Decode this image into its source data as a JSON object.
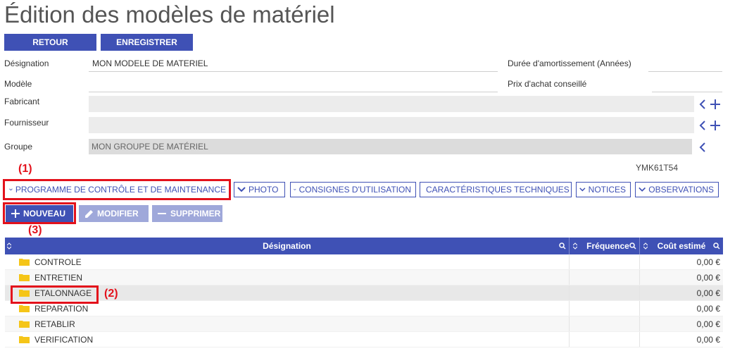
{
  "page": {
    "title": "Édition des modèles de matériel"
  },
  "toolbar": {
    "back_label": "RETOUR",
    "save_label": "ENREGISTRER"
  },
  "form": {
    "designation_label": "Désignation",
    "designation_value": "MON MODELE DE MATERIEL",
    "modele_label": "Modèle",
    "modele_value": "",
    "fabricant_label": "Fabricant",
    "fournisseur_label": "Fournisseur",
    "groupe_label": "Groupe",
    "groupe_value": "MON GROUPE DE MATÉRIEL",
    "duree_label": "Durée d'amortissement (Années)",
    "duree_value": "",
    "prix_label": "Prix d'achat conseillé",
    "prix_value": "",
    "code": "YMK61T54"
  },
  "tabs": [
    {
      "label": "PROGRAMME DE CONTRÔLE ET DE MAINTENANCE"
    },
    {
      "label": "PHOTO"
    },
    {
      "label": "CONSIGNES D'UTILISATION"
    },
    {
      "label": "CARACTÉRISTIQUES TECHNIQUES"
    },
    {
      "label": "NOTICES"
    },
    {
      "label": "OBSERVATIONS"
    }
  ],
  "actions": {
    "new_label": "NOUVEAU",
    "edit_label": "MODIFIER",
    "delete_label": "SUPPRIMER"
  },
  "annotations": {
    "a1": "(1)",
    "a2": "(2)",
    "a3": "(3)"
  },
  "table": {
    "columns": [
      "Désignation",
      "Fréquence",
      "Coût estimé"
    ],
    "rows": [
      {
        "designation": "CONTROLE",
        "frequence": "",
        "cout": "0,00 €"
      },
      {
        "designation": "ENTRETIEN",
        "frequence": "",
        "cout": "0,00 €"
      },
      {
        "designation": "ETALONNAGE",
        "frequence": "",
        "cout": "0,00 €"
      },
      {
        "designation": "REPARATION",
        "frequence": "",
        "cout": "0,00 €"
      },
      {
        "designation": "RETABLIR",
        "frequence": "",
        "cout": "0,00 €"
      },
      {
        "designation": "VERIFICATION",
        "frequence": "",
        "cout": "0,00 €"
      }
    ]
  },
  "colors": {
    "primary": "#3f51b5",
    "primary_disabled": "#9fa8da",
    "highlight": "#e3111b",
    "folder": "#f5c518"
  },
  "icons": [
    "chevron-left-icon",
    "plus-icon",
    "chevron-down-icon",
    "pencil-icon",
    "minus-icon",
    "sort-icon",
    "search-icon",
    "folder-icon"
  ]
}
